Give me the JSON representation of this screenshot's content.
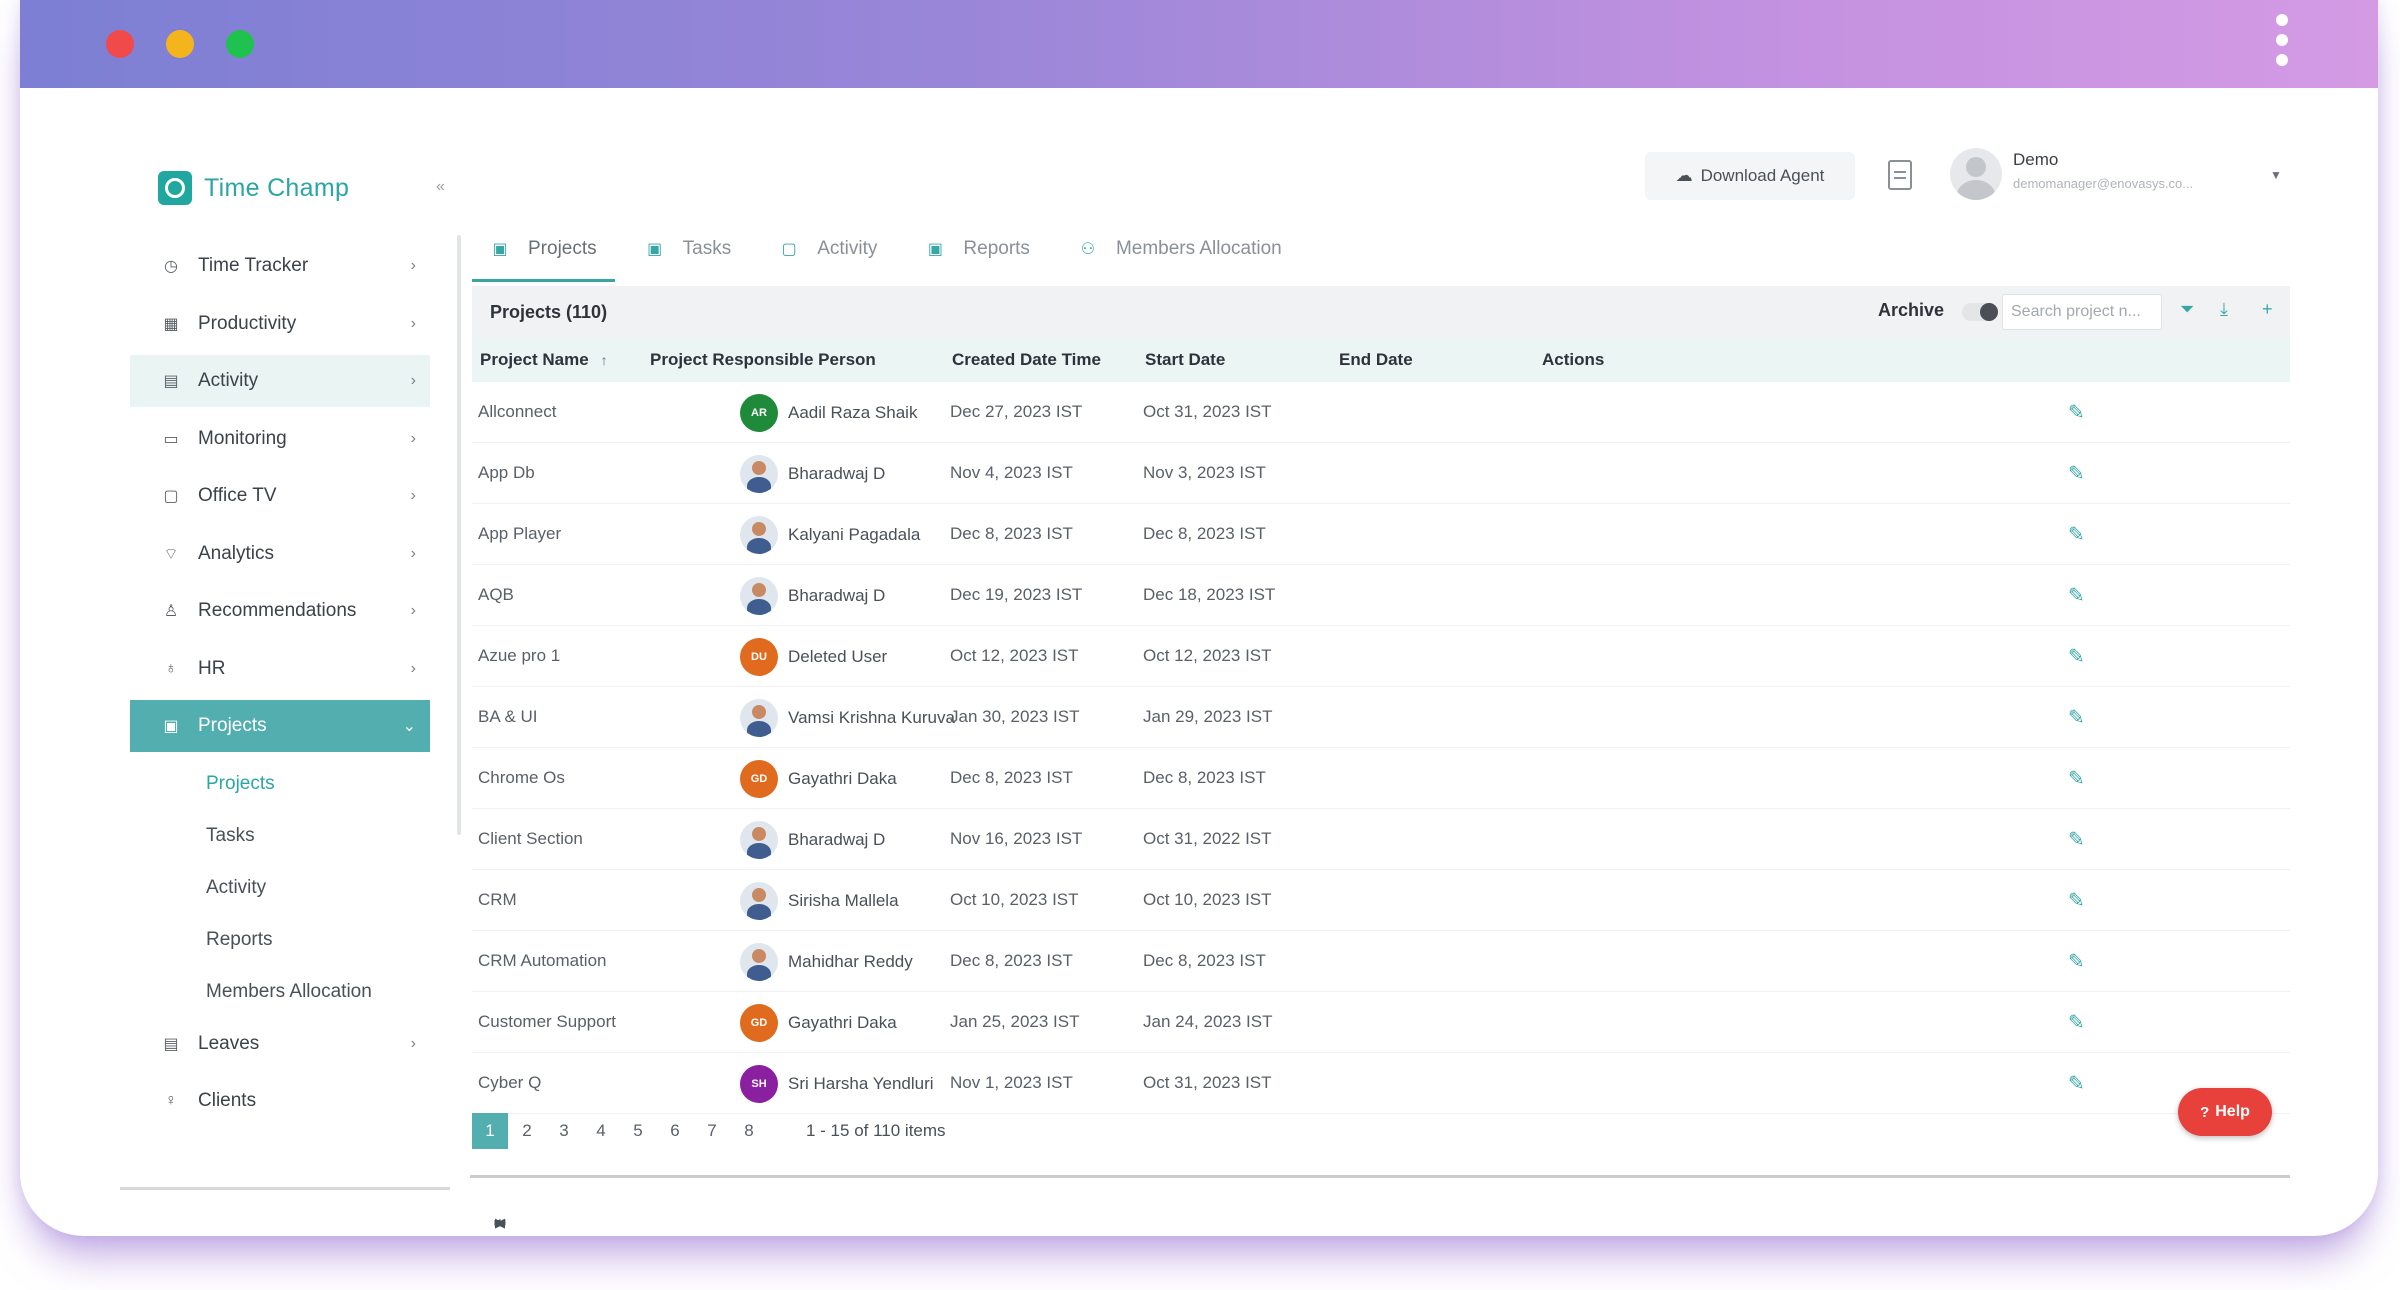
{
  "window": {
    "title_bar": ""
  },
  "brand": {
    "name": "Time Champ",
    "collapse_icon": "«"
  },
  "sidebar": {
    "items": [
      {
        "label": "Time Tracker",
        "icon": "◷"
      },
      {
        "label": "Productivity",
        "icon": "▦"
      },
      {
        "label": "Activity",
        "icon": "▤"
      },
      {
        "label": "Monitoring",
        "icon": "▭"
      },
      {
        "label": "Office TV",
        "icon": "▢"
      },
      {
        "label": "Analytics",
        "icon": "⌔"
      },
      {
        "label": "Recommendations",
        "icon": "♙"
      },
      {
        "label": "HR",
        "icon": "♁"
      },
      {
        "label": "Projects",
        "icon": "▣"
      }
    ],
    "sub_items": [
      "Projects",
      "Tasks",
      "Activity",
      "Reports",
      "Members Allocation"
    ],
    "bottom_items": [
      {
        "label": "Leaves",
        "icon": "▤"
      },
      {
        "label": "Clients",
        "icon": "♀"
      }
    ]
  },
  "header": {
    "download_label": "Download Agent",
    "user_name": "Demo",
    "user_email": "demomanager@enovasys.co..."
  },
  "tabs": [
    {
      "label": "Projects"
    },
    {
      "label": "Tasks"
    },
    {
      "label": "Activity"
    },
    {
      "label": "Reports"
    },
    {
      "label": "Members Allocation"
    }
  ],
  "grid": {
    "title": "Projects (110)",
    "archive_label": "Archive",
    "search_placeholder": "Search project n...",
    "columns": [
      "Project Name",
      "Project Responsible Person",
      "Created Date Time",
      "Start Date",
      "End Date",
      "Actions"
    ],
    "rows": [
      {
        "project": "Allconnect",
        "person": "Aadil Raza Shaik",
        "initials": "AR",
        "avatar_color": "#1e8a3a",
        "created": "Dec 27, 2023 IST",
        "start": "Oct 31, 2023 IST",
        "end": ""
      },
      {
        "project": "App Db",
        "person": "Bharadwaj D",
        "initials": "",
        "avatar_color": "photo",
        "created": "Nov 4, 2023 IST",
        "start": "Nov 3, 2023 IST",
        "end": ""
      },
      {
        "project": "App Player",
        "person": "Kalyani Pagadala",
        "initials": "",
        "avatar_color": "photo",
        "created": "Dec 8, 2023 IST",
        "start": "Dec 8, 2023 IST",
        "end": ""
      },
      {
        "project": "AQB",
        "person": "Bharadwaj D",
        "initials": "",
        "avatar_color": "photo",
        "created": "Dec 19, 2023 IST",
        "start": "Dec 18, 2023 IST",
        "end": ""
      },
      {
        "project": "Azue pro 1",
        "person": "Deleted User",
        "initials": "DU",
        "avatar_color": "#e06b1f",
        "created": "Oct 12, 2023 IST",
        "start": "Oct 12, 2023 IST",
        "end": ""
      },
      {
        "project": "BA & UI",
        "person": "Vamsi Krishna Kuruva",
        "initials": "",
        "avatar_color": "photo",
        "created": "Jan 30, 2023 IST",
        "start": "Jan 29, 2023 IST",
        "end": ""
      },
      {
        "project": "Chrome Os",
        "person": "Gayathri Daka",
        "initials": "GD",
        "avatar_color": "#e06b1f",
        "created": "Dec 8, 2023 IST",
        "start": "Dec 8, 2023 IST",
        "end": ""
      },
      {
        "project": "Client Section",
        "person": "Bharadwaj D",
        "initials": "",
        "avatar_color": "photo",
        "created": "Nov 16, 2023 IST",
        "start": "Oct 31, 2022 IST",
        "end": ""
      },
      {
        "project": "CRM",
        "person": "Sirisha Mallela",
        "initials": "",
        "avatar_color": "photo",
        "created": "Oct 10, 2023 IST",
        "start": "Oct 10, 2023 IST",
        "end": ""
      },
      {
        "project": "CRM Automation",
        "person": "Mahidhar Reddy",
        "initials": "",
        "avatar_color": "photo",
        "created": "Dec 8, 2023 IST",
        "start": "Dec 8, 2023 IST",
        "end": ""
      },
      {
        "project": "Customer Support",
        "person": "Gayathri Daka",
        "initials": "GD",
        "avatar_color": "#e06b1f",
        "created": "Jan 25, 2023 IST",
        "start": "Jan 24, 2023 IST",
        "end": ""
      },
      {
        "project": "Cyber Q",
        "person": "Sri Harsha Yendluri",
        "initials": "SH",
        "avatar_color": "#8a1fa0",
        "created": "Nov 1, 2023 IST",
        "start": "Oct 31, 2023 IST",
        "end": ""
      }
    ],
    "edit_icon": "✎"
  },
  "pager": {
    "first": "⏮",
    "prev": "◀",
    "next": "▶",
    "last": "⏭",
    "pages": [
      "1",
      "2",
      "3",
      "4",
      "5",
      "6",
      "7",
      "8"
    ],
    "current": "1",
    "info": "1 - 15 of 110 items"
  },
  "help": {
    "label": "Help",
    "icon": "?"
  },
  "colors": {
    "accent": "#53aeb0",
    "teal": "#37a7a6",
    "help": "#e8403a"
  }
}
